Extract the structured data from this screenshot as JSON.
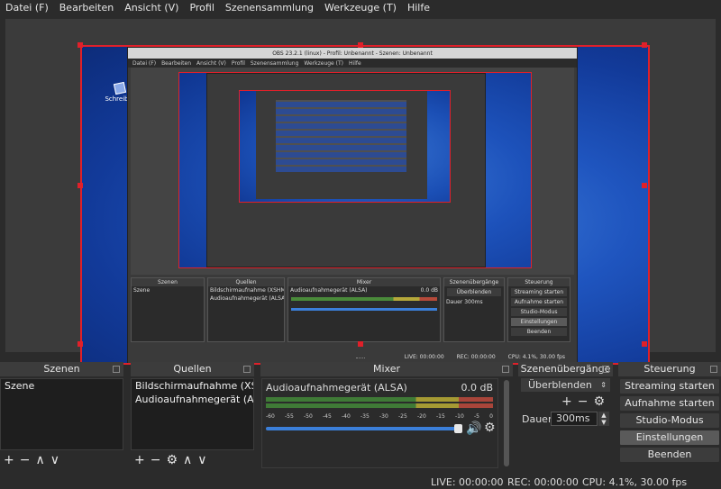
{
  "menu": [
    "Datei (F)",
    "Bearbeiten",
    "Ansicht (V)",
    "Profil",
    "Szenensammlung",
    "Werkzeuge (T)",
    "Hilfe"
  ],
  "desktop": {
    "icon_label": "Schreib-S"
  },
  "nested": {
    "title": "OBS 23.2.1 (linux) - Profil: Unbenannt - Szenen: Unbenannt",
    "menu": [
      "Datei (F)",
      "Bearbeiten",
      "Ansicht (V)",
      "Profil",
      "Szenensammlung",
      "Werkzeuge (T)",
      "Hilfe"
    ],
    "scenes_title": "Szenen",
    "scene": "Szene",
    "sources_title": "Quellen",
    "sources": [
      "Bildschirmaufnahme (XSHM)",
      "Audioaufnahmegerät (ALSA)"
    ],
    "mixer_title": "Mixer",
    "mixer_track": "Audioaufnahmegerät (ALSA)",
    "mixer_db": "0.0 dB",
    "transitions_title": "Szenenübergänge",
    "transition": "Überblenden",
    "duration_label": "Dauer",
    "duration": "300ms",
    "controls_title": "Steuerung",
    "controls": [
      "Streaming starten",
      "Aufnahme starten",
      "Studio-Modus",
      "Einstellungen",
      "Beenden"
    ],
    "live": "LIVE: 00:00:00",
    "rec": "REC: 00:00:00",
    "cpu": "CPU: 4.1%, 30.00 fps"
  },
  "docks": {
    "scenes": {
      "title": "Szenen",
      "items": [
        "Szene"
      ]
    },
    "sources": {
      "title": "Quellen",
      "items": [
        "Bildschirmaufnahme (XSHM)",
        "Audioaufnahmegerät (ALSA)"
      ]
    },
    "mixer": {
      "title": "Mixer",
      "track": "Audioaufnahmegerät (ALSA)",
      "db": "0.0 dB",
      "ticks": [
        "-60",
        "-55",
        "-50",
        "-45",
        "-40",
        "-35",
        "-30",
        "-25",
        "-20",
        "-15",
        "-10",
        "-5",
        "0"
      ],
      "volume_level": 1.0
    },
    "transitions": {
      "title": "Szenenübergänge",
      "selected": "Überblenden",
      "duration_label": "Dauer",
      "duration": "300ms"
    },
    "controls": {
      "title": "Steuerung",
      "streaming": "Streaming starten",
      "recording": "Aufnahme starten",
      "studio": "Studio-Modus",
      "settings": "Einstellungen",
      "exit": "Beenden"
    }
  },
  "status": {
    "live": "LIVE: 00:00:00",
    "rec": "REC: 00:00:00",
    "cpu": "CPU: 4.1%, 30.00 fps"
  },
  "colors": {
    "selection": "#e0202a",
    "background": "#2b2b2b",
    "panel": "#3c3c3c"
  }
}
